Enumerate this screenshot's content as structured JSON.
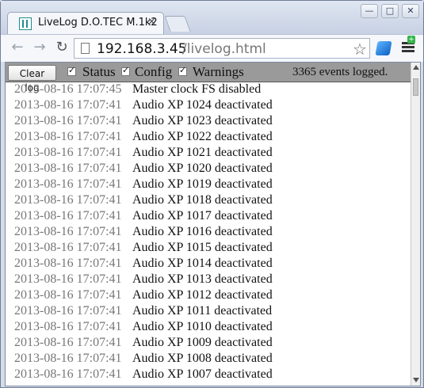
{
  "browser": {
    "tab_title": "LiveLog D.O.TEC M.1k2",
    "tab_close": "×",
    "url_host": "192.168.3.45",
    "url_path": "/livelog.html",
    "star_icon": "star-icon",
    "extension_icon": "extension-icon",
    "menu_icon": "menu-icon",
    "menu_badge": "+"
  },
  "controls": {
    "clear_label": "Clear log",
    "filters": [
      {
        "label": "Status",
        "checked": true
      },
      {
        "label": "Config",
        "checked": true
      },
      {
        "label": "Warnings",
        "checked": true
      }
    ],
    "events_logged": "3365 events logged."
  },
  "log": {
    "rows": [
      {
        "time": "2013-08-16 17:07:45",
        "message": "Master clock FS disabled"
      },
      {
        "time": "2013-08-16 17:07:41",
        "message": "Audio XP 1024 deactivated"
      },
      {
        "time": "2013-08-16 17:07:41",
        "message": "Audio XP 1023 deactivated"
      },
      {
        "time": "2013-08-16 17:07:41",
        "message": "Audio XP 1022 deactivated"
      },
      {
        "time": "2013-08-16 17:07:41",
        "message": "Audio XP 1021 deactivated"
      },
      {
        "time": "2013-08-16 17:07:41",
        "message": "Audio XP 1020 deactivated"
      },
      {
        "time": "2013-08-16 17:07:41",
        "message": "Audio XP 1019 deactivated"
      },
      {
        "time": "2013-08-16 17:07:41",
        "message": "Audio XP 1018 deactivated"
      },
      {
        "time": "2013-08-16 17:07:41",
        "message": "Audio XP 1017 deactivated"
      },
      {
        "time": "2013-08-16 17:07:41",
        "message": "Audio XP 1016 deactivated"
      },
      {
        "time": "2013-08-16 17:07:41",
        "message": "Audio XP 1015 deactivated"
      },
      {
        "time": "2013-08-16 17:07:41",
        "message": "Audio XP 1014 deactivated"
      },
      {
        "time": "2013-08-16 17:07:41",
        "message": "Audio XP 1013 deactivated"
      },
      {
        "time": "2013-08-16 17:07:41",
        "message": "Audio XP 1012 deactivated"
      },
      {
        "time": "2013-08-16 17:07:41",
        "message": "Audio XP 1011 deactivated"
      },
      {
        "time": "2013-08-16 17:07:41",
        "message": "Audio XP 1010 deactivated"
      },
      {
        "time": "2013-08-16 17:07:41",
        "message": "Audio XP 1009 deactivated"
      },
      {
        "time": "2013-08-16 17:07:41",
        "message": "Audio XP 1008 deactivated"
      },
      {
        "time": "2013-08-16 17:07:41",
        "message": "Audio XP 1007 deactivated"
      }
    ]
  }
}
